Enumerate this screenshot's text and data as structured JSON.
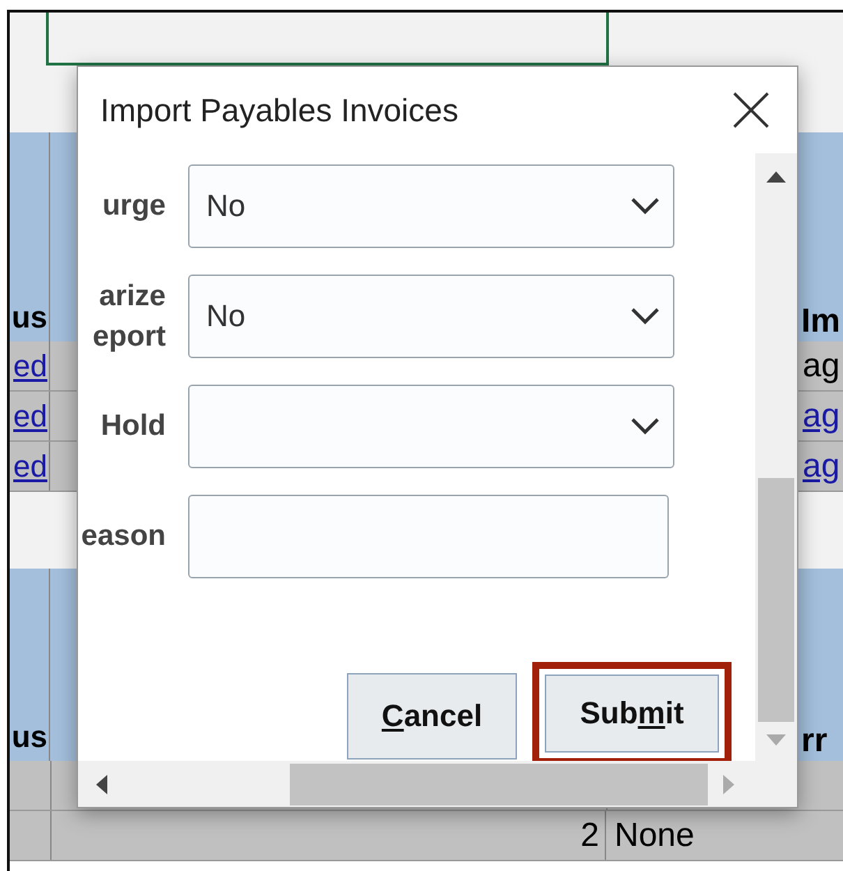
{
  "sheet": {
    "upper_header": {
      "column_1": "us",
      "column_3": "Im"
    },
    "upper_rows": [
      {
        "column_1": {
          "text": "ed",
          "link": true
        },
        "column_3": {
          "text": "ag",
          "link": false
        }
      },
      {
        "column_1": {
          "text": "ed",
          "link": true
        },
        "column_3": {
          "text": "ag",
          "link": true
        }
      },
      {
        "column_1": {
          "text": "ed",
          "link": true
        },
        "column_3": {
          "text": "ag",
          "link": true
        }
      }
    ],
    "lower_header": {
      "column_1": "us",
      "column_3": "rr"
    },
    "lower_rows": [
      {
        "column_2": "2",
        "column_3": "None"
      }
    ]
  },
  "dialog": {
    "title": "Import Payables Invoices",
    "fields": [
      {
        "label": "urge",
        "kind": "select",
        "value": "No"
      },
      {
        "label": "arize\neport",
        "kind": "select",
        "value": "No"
      },
      {
        "label": "Hold",
        "kind": "select"
      },
      {
        "label": "eason",
        "kind": "text"
      }
    ],
    "buttons": [
      {
        "label_parts": [
          {
            "text": "C",
            "underlined": true
          },
          {
            "text": "ancel",
            "underlined": false
          }
        ],
        "highlighted": false
      },
      {
        "label_parts": [
          {
            "text": "Sub",
            "underlined": false
          },
          {
            "text": "m",
            "underlined": true
          },
          {
            "text": "it",
            "underlined": false
          }
        ],
        "highlighted": true
      }
    ]
  }
}
